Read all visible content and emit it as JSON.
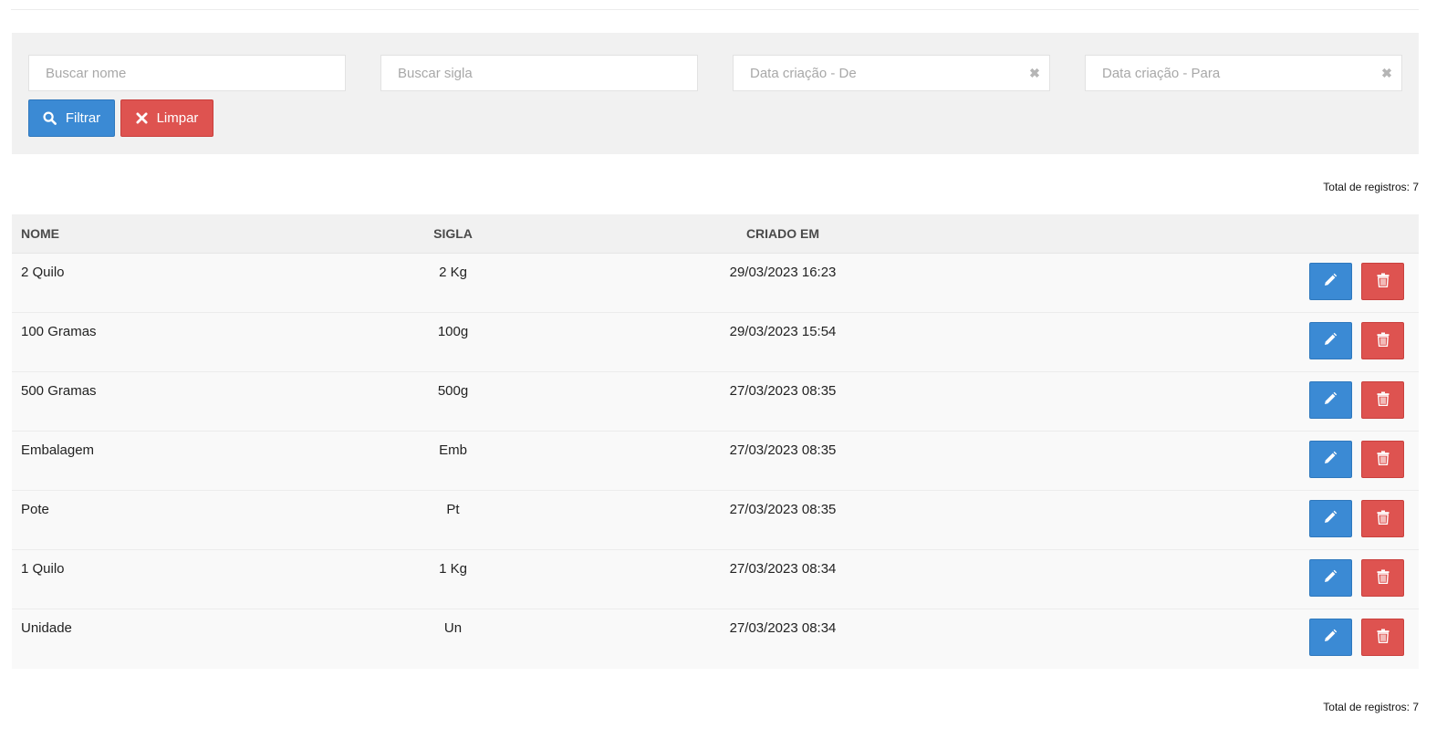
{
  "filters": {
    "name_placeholder": "Buscar nome",
    "sigla_placeholder": "Buscar sigla",
    "date_from_placeholder": "Data criação - De",
    "date_to_placeholder": "Data criação - Para",
    "filter_label": "Filtrar",
    "clear_label": "Limpar"
  },
  "summary": {
    "total_label": "Total de registros: 7"
  },
  "table": {
    "headers": {
      "name": "NOME",
      "sigla": "SIGLA",
      "created": "CRIADO EM"
    },
    "rows": [
      {
        "name": "2 Quilo",
        "sigla": "2 Kg",
        "created": "29/03/2023 16:23"
      },
      {
        "name": "100 Gramas",
        "sigla": "100g",
        "created": "29/03/2023 15:54"
      },
      {
        "name": "500 Gramas",
        "sigla": "500g",
        "created": "27/03/2023 08:35"
      },
      {
        "name": "Embalagem",
        "sigla": "Emb",
        "created": "27/03/2023 08:35"
      },
      {
        "name": "Pote",
        "sigla": "Pt",
        "created": "27/03/2023 08:35"
      },
      {
        "name": "1 Quilo",
        "sigla": "1 Kg",
        "created": "27/03/2023 08:34"
      },
      {
        "name": "Unidade",
        "sigla": "Un",
        "created": "27/03/2023 08:34"
      }
    ]
  },
  "icons": {
    "search": "search-icon",
    "clear": "times-icon",
    "edit": "pencil-icon",
    "delete": "trash-icon"
  },
  "colors": {
    "primary": "#3b8ad4",
    "danger": "#de5350",
    "panel": "#f1f1f1"
  }
}
